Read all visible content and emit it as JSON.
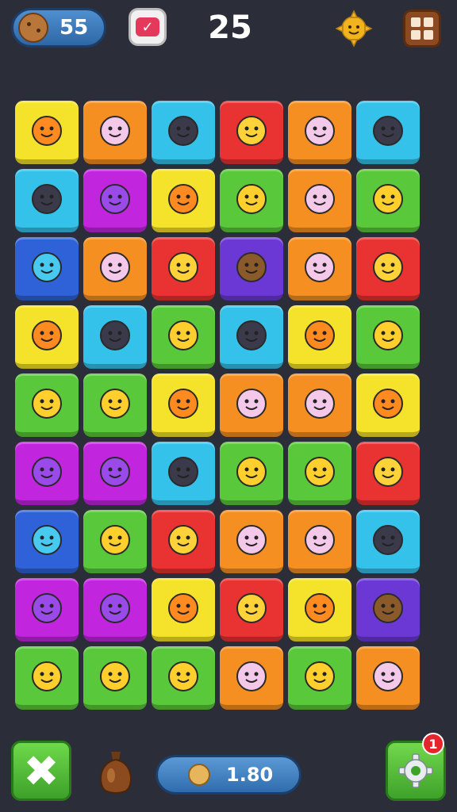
{
  "hud": {
    "coins": "55",
    "moves_counter": "25",
    "score": "1.80",
    "notification_count": "1"
  },
  "colors": {
    "yellow": "#f4e32a",
    "orange": "#f68f22",
    "cyan": "#35c2ea",
    "red": "#e93232",
    "green": "#59c83a",
    "magenta": "#c125de",
    "purple": "#6b38d6",
    "blue": "#2f62d8",
    "pink": "#e34fb0"
  },
  "board": {
    "rows": [
      [
        {
          "color": "yellow",
          "icon": "leaf-icon"
        },
        {
          "color": "orange",
          "icon": "cat-icon"
        },
        {
          "color": "cyan",
          "icon": "black-cat-icon"
        },
        {
          "color": "red",
          "icon": "smiley-icon"
        },
        {
          "color": "orange",
          "icon": "dog-icon"
        },
        {
          "color": "cyan",
          "icon": "heart-icon"
        }
      ],
      [
        {
          "color": "cyan",
          "icon": "crate-icon"
        },
        {
          "color": "magenta",
          "icon": "orb-icon"
        },
        {
          "color": "yellow",
          "icon": "wand-icon"
        },
        {
          "color": "green",
          "icon": "turtle-icon"
        },
        {
          "color": "orange",
          "icon": "ghost-icon"
        },
        {
          "color": "green",
          "icon": "bubble-icon"
        }
      ],
      [
        {
          "color": "blue",
          "icon": "chat-bubble-icon"
        },
        {
          "color": "orange",
          "icon": "pig-icon"
        },
        {
          "color": "red",
          "icon": "face-icon"
        },
        {
          "color": "purple",
          "icon": "monkey-icon"
        },
        {
          "color": "orange",
          "icon": "leaf-icon"
        },
        {
          "color": "red",
          "icon": "devil-icon"
        }
      ],
      [
        {
          "color": "yellow",
          "icon": "chat-bubble-icon"
        },
        {
          "color": "cyan",
          "icon": "alien-icon"
        },
        {
          "color": "green",
          "icon": "chest-icon"
        },
        {
          "color": "cyan",
          "icon": "checkmark-icon"
        },
        {
          "color": "yellow",
          "icon": "smiley-icon"
        },
        {
          "color": "green",
          "icon": "keyboard-icon"
        }
      ],
      [
        {
          "color": "green",
          "icon": "bunny-icon"
        },
        {
          "color": "green",
          "icon": "heart-badge-icon"
        },
        {
          "color": "yellow",
          "icon": "burger-icon"
        },
        {
          "color": "orange",
          "icon": "ghost-icon"
        },
        {
          "color": "orange",
          "icon": "imp-icon"
        },
        {
          "color": "yellow",
          "icon": "flower-icon"
        }
      ],
      [
        {
          "color": "magenta",
          "icon": "smiley-icon"
        },
        {
          "color": "magenta",
          "icon": "tiger-icon"
        },
        {
          "color": "cyan",
          "icon": "ticket-icon"
        },
        {
          "color": "green",
          "icon": "map-icon"
        },
        {
          "color": "green",
          "icon": "orb-icon"
        },
        {
          "color": "red",
          "icon": "ice-cream-icon"
        }
      ],
      [
        {
          "color": "blue",
          "icon": "spiky-ball-icon"
        },
        {
          "color": "green",
          "icon": "cookie-icon"
        },
        {
          "color": "red",
          "icon": "spiky-check-icon"
        },
        {
          "color": "orange",
          "icon": "blob-icon"
        },
        {
          "color": "orange",
          "icon": "cat-icon"
        },
        {
          "color": "cyan",
          "icon": "film-icon"
        }
      ],
      [
        {
          "color": "magenta",
          "icon": "chat-bubble-icon"
        },
        {
          "color": "magenta",
          "icon": "virus-icon"
        },
        {
          "color": "yellow",
          "icon": "robot-icon"
        },
        {
          "color": "red",
          "icon": "no-sign-icon"
        },
        {
          "color": "yellow",
          "icon": "gear-ball-icon"
        },
        {
          "color": "purple",
          "icon": "orb-icon"
        }
      ],
      [
        {
          "color": "green",
          "icon": "pencil-icon"
        },
        {
          "color": "green",
          "icon": "gamepad-icon"
        },
        {
          "color": "green",
          "icon": "bubble-icon"
        },
        {
          "color": "orange",
          "icon": "bear-icon"
        },
        {
          "color": "green",
          "icon": "balloon-icon"
        },
        {
          "color": "orange",
          "icon": "donut-icon"
        }
      ]
    ]
  }
}
